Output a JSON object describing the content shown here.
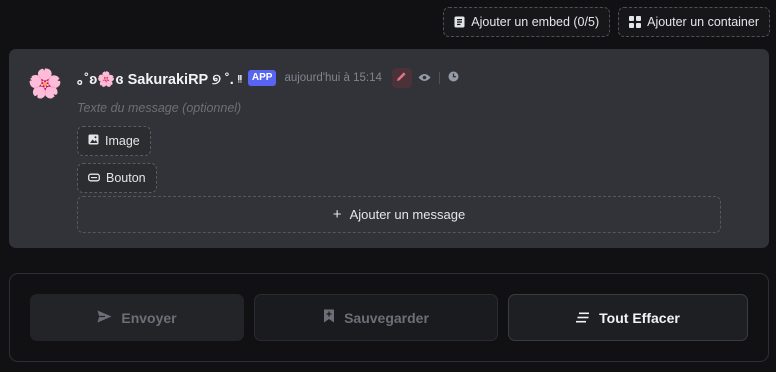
{
  "toolbar": {
    "add_embed_label": "Ajouter un embed (0/5)",
    "add_container_label": "Ajouter un container"
  },
  "message": {
    "avatar_glyph": "🌸",
    "username": "｡˚ʚ🌸ɞ SakurakiRP ୭ ˚. ᵎᵎ",
    "badge": "APP",
    "timestamp": "aujourd'hui à 15:14",
    "text_placeholder": "Texte du message (optionnel)",
    "components": {
      "image_label": "Image",
      "button_label": "Bouton"
    },
    "add_message_label": "Ajouter un message"
  },
  "actions": {
    "send_label": "Envoyer",
    "save_label": "Sauvegarder",
    "clear_label": "Tout Effacer"
  },
  "colors": {
    "background": "#111113",
    "card": "#313338",
    "badge": "#5865f2",
    "edit_accent": "#e0748a"
  }
}
